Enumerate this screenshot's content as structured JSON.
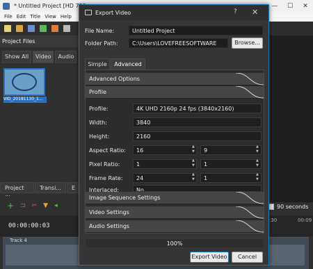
{
  "app": {
    "title": "* Untitled Project [HD 720p 30 fps] - OpenShot Video Editor",
    "menu": [
      "File",
      "Edit",
      "Title",
      "View",
      "Help"
    ],
    "project_files_header": "Project Files",
    "filter_tabs": [
      "Show All",
      "Video",
      "Audio"
    ],
    "thumbnail_label": "VID_20181130_1...",
    "bottom_tabs": [
      "Project ...",
      "Transi...",
      "E"
    ],
    "timecode": "00:00:00:03",
    "track_label": "Track 4",
    "seconds_label": "90 seconds",
    "ruler_labels": [
      ":30",
      "00:09"
    ]
  },
  "dialog": {
    "title": "Export Video",
    "help_label": "?",
    "close_label": "✕",
    "file_name_label": "File Name:",
    "file_name_value": "Untitled Project",
    "folder_path_label": "Folder Path:",
    "folder_path_value": "C:\\Users\\LOVEFREESOFTWARE",
    "browse_label": "Browse...",
    "tabs": [
      "Simple",
      "Advanced"
    ],
    "active_tab": "Advanced",
    "sections": {
      "advanced_options": "Advanced Options",
      "profile": "Profile",
      "image_sequence": "Image Sequence Settings",
      "video": "Video Settings",
      "audio": "Audio Settings"
    },
    "profile": {
      "profile_label": "Profile:",
      "profile_value": "4K UHD 2160p 24 fps (3840x2160)",
      "width_label": "Width:",
      "width_value": "3840",
      "height_label": "Height:",
      "height_value": "2160",
      "aspect_label": "Aspect Ratio:",
      "aspect_num": "16",
      "aspect_den": "9",
      "pixel_label": "Pixel Ratio:",
      "pixel_num": "1",
      "pixel_den": "1",
      "frame_label": "Frame Rate:",
      "frame_num": "24",
      "frame_den": "1",
      "interlaced_label": "Interlaced:",
      "interlaced_value": "No"
    },
    "progress_text": "100%",
    "progress_fraction": 1.0,
    "export_label": "Export Video",
    "cancel_label": "Cancel"
  }
}
